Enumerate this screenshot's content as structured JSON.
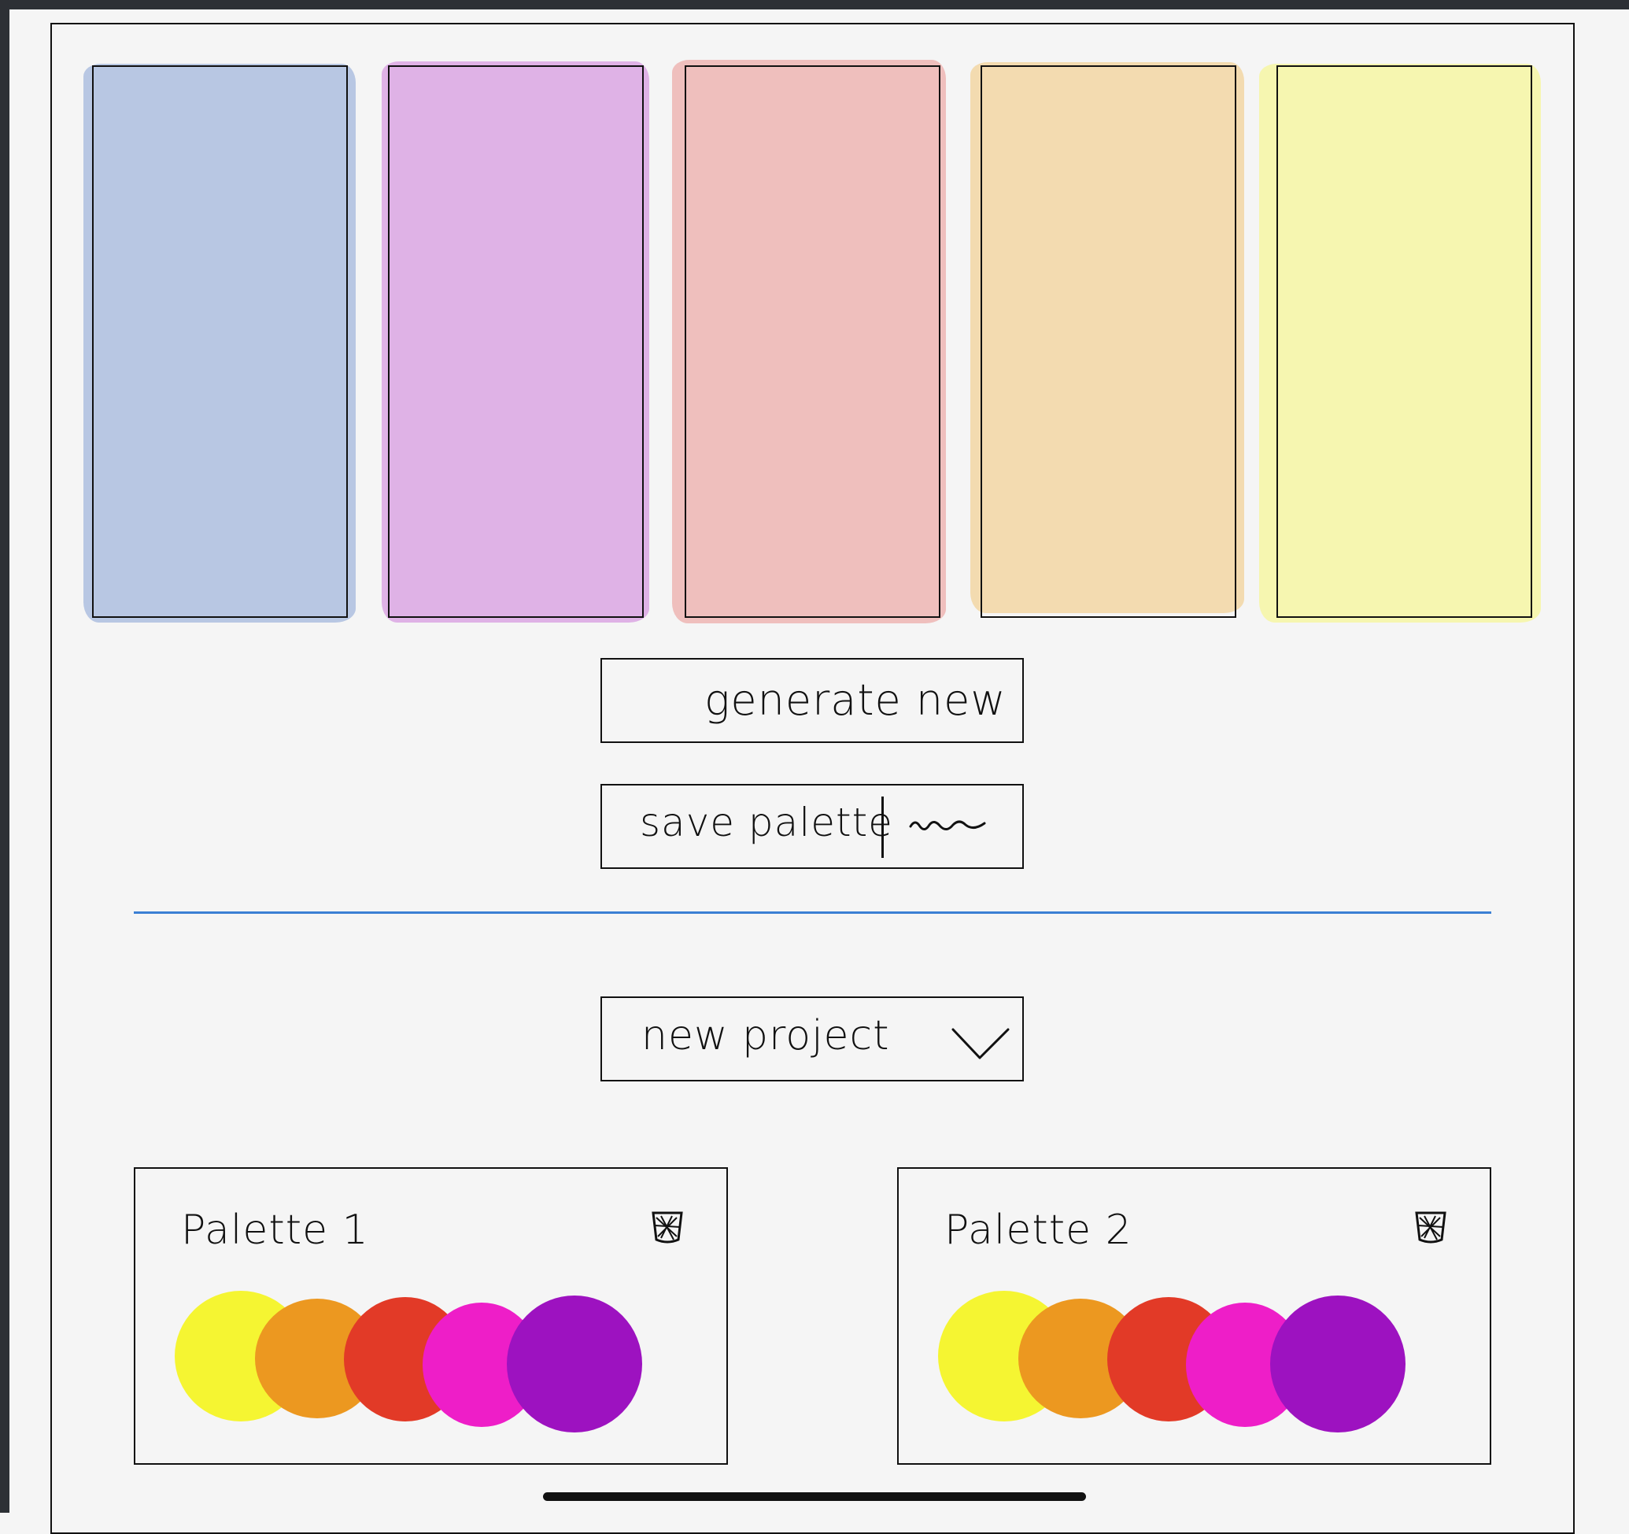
{
  "swatches": [
    {
      "name": "swatch-1",
      "color": "#b8c7e3"
    },
    {
      "name": "swatch-2",
      "color": "#dfb2e6"
    },
    {
      "name": "swatch-3",
      "color": "#efbfbd"
    },
    {
      "name": "swatch-4",
      "color": "#f3dbb0"
    },
    {
      "name": "swatch-5",
      "color": "#f6f6b0"
    }
  ],
  "actions": {
    "generate_label": "generate new",
    "save_label": "save palette",
    "save_name_scribble": "~~~"
  },
  "divider_color": "#3b7fd4",
  "project_select": {
    "selected": "new project",
    "icon": "chevron-down-icon"
  },
  "palettes": [
    {
      "title": "Palette 1",
      "icon": "trash-icon",
      "colors": [
        "#f5f532",
        "#ec9820",
        "#e23a27",
        "#ee1ec8",
        "#9d12c0"
      ]
    },
    {
      "title": "Palette 2",
      "icon": "trash-icon",
      "colors": [
        "#f5f532",
        "#ec9820",
        "#e23a27",
        "#ee1ec8",
        "#9d12c0"
      ]
    }
  ]
}
